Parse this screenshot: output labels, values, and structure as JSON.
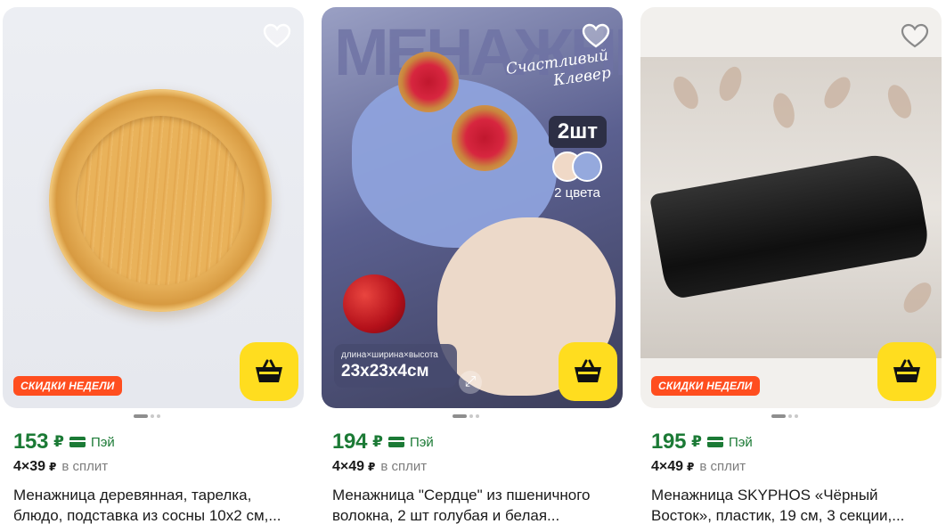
{
  "products": [
    {
      "title": "Менажница деревянная, тарелка, блюдо, подставка из сосны 10х2 см,...",
      "price": "153",
      "currency": "₽",
      "pay_label": "Пэй",
      "split_amount": "4×39",
      "split_currency": "₽",
      "split_label": "в сплит",
      "badge": "СКИДКИ НЕДЕЛИ"
    },
    {
      "title": "Менажница \"Сердце\" из пшеничного волокна, 2 шт голубая и белая...",
      "price": "194",
      "currency": "₽",
      "pay_label": "Пэй",
      "split_amount": "4×49",
      "split_currency": "₽",
      "split_label": "в сплит",
      "poster_word": "МЕНАЖНИЦЫ",
      "poster_script_1": "Счастливый",
      "poster_script_2": "Клевер",
      "qty": "2шт",
      "colors_label": "2 цвета",
      "dims_label": "длина×ширина×высота",
      "dims_value": "23х23х4см"
    },
    {
      "title": "Менажница SKYPHOS «Чёрный Восток», пластик, 19 см, 3 секции,...",
      "price": "195",
      "currency": "₽",
      "pay_label": "Пэй",
      "split_amount": "4×49",
      "split_currency": "₽",
      "split_label": "в сплит",
      "badge": "СКИДКИ НЕДЕЛИ"
    }
  ],
  "colors": {
    "price_green": "#1b7a35",
    "basket_yellow": "#ffdd1f",
    "badge_orange": "#ff4e1f"
  },
  "icons": [
    "heart-icon",
    "basket-icon",
    "pay-card-icon",
    "expand-icon"
  ]
}
